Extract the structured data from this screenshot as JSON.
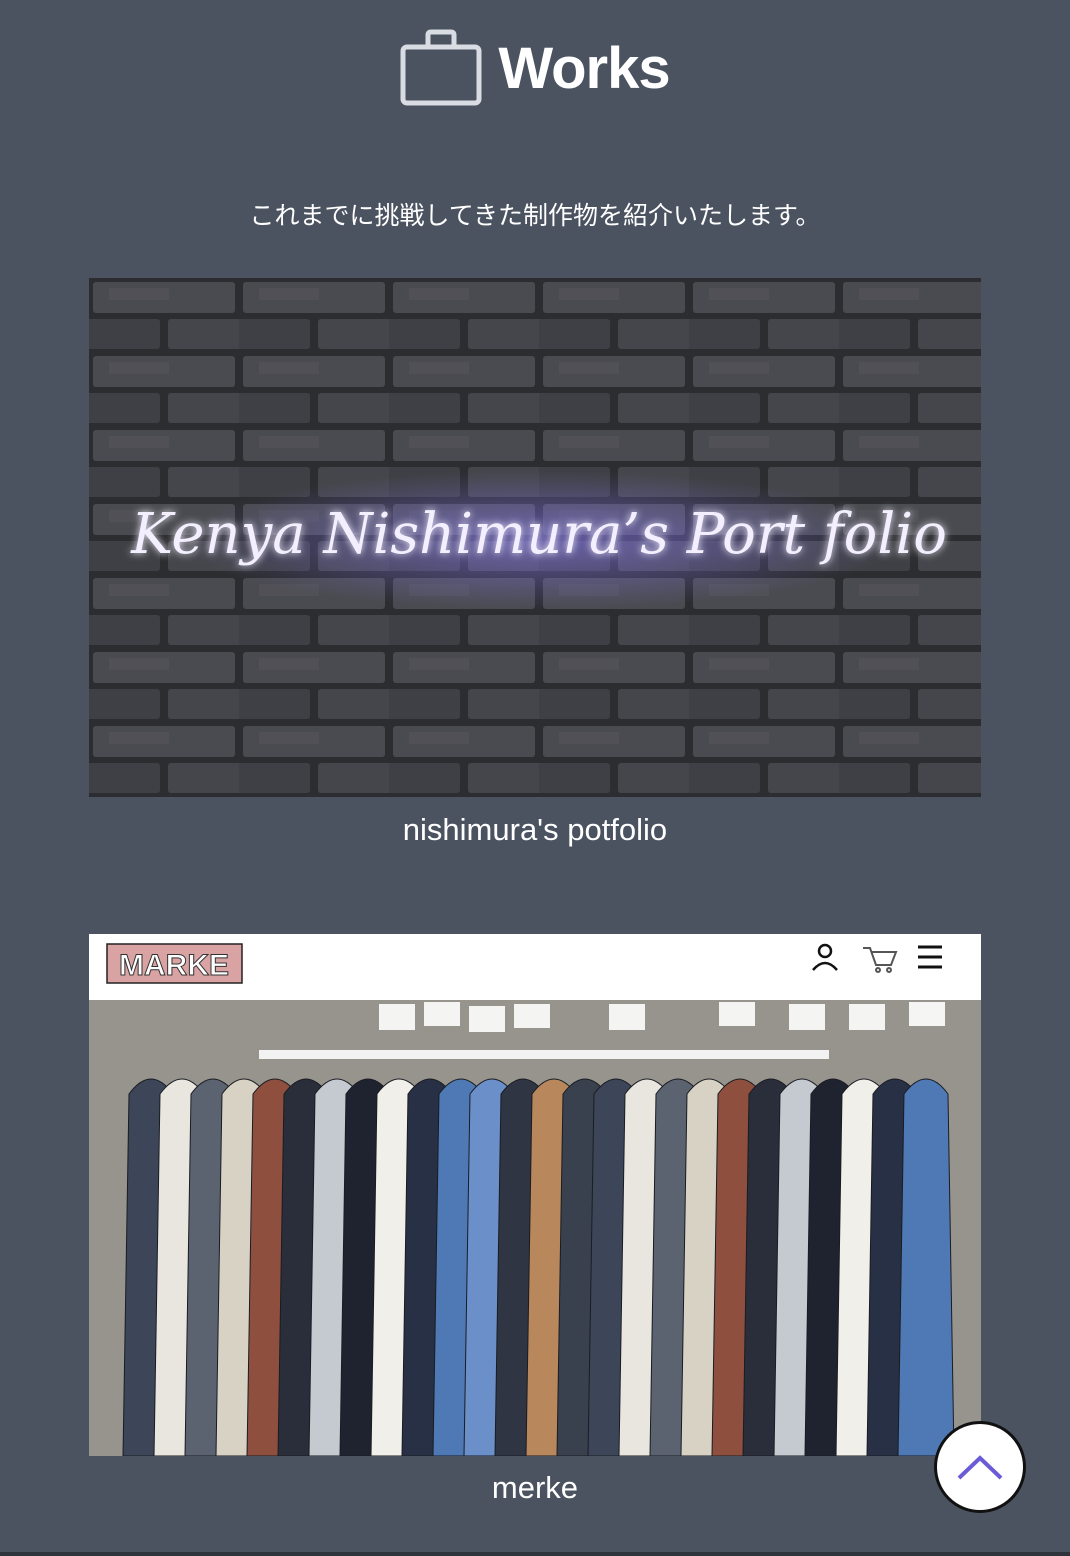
{
  "section": {
    "title": "Works",
    "icon": "briefcase-icon",
    "intro": "これまでに挑戦してきた制作物を紹介いたします。"
  },
  "works": [
    {
      "image_text": "Kenya Nishimura’s  Port folio",
      "caption": "nishimura's potfolio"
    },
    {
      "image_logo": "MARKE",
      "image_icons": [
        "user-icon",
        "cart-icon",
        "menu-icon"
      ],
      "caption": "merke"
    }
  ],
  "scroll_top": {
    "icon": "chevron-up-icon"
  },
  "colors": {
    "background": "#4b5361",
    "text": "#ffffff",
    "accent": "#6a5cd6",
    "logo_bg": "#d9a3a3"
  }
}
